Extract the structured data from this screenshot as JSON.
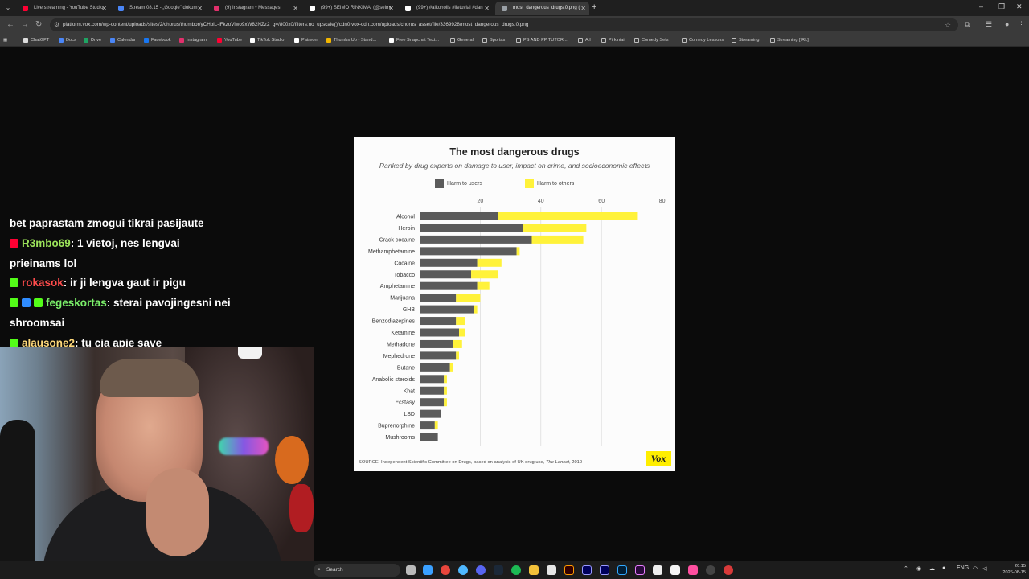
{
  "browser": {
    "tabs": [
      {
        "title": "Live streaming - YouTube Studio",
        "color": "#ff0033"
      },
      {
        "title": "Stream 08.15 - „Google\" dokum",
        "color": "#4a86f7"
      },
      {
        "title": "(9) Instagram • Messages",
        "color": "#e1306c"
      },
      {
        "title": "(99+) SEIMO RINKIMAI (@seimo",
        "color": "#ffffff"
      },
      {
        "title": "(99+) #alkoholis #lietuviai #dan",
        "color": "#ffffff"
      },
      {
        "title": "most_dangerous_drugs.0.png (",
        "color": "#9aa0a6"
      }
    ],
    "new_tab": "+",
    "url": "platform.vox.com/wp-content/uploads/sites/2/chorus/thumbor/yCHbiL-iFkzoViwo9xW82NZz2_g=/800x0/filters:no_upscale()/cdn0.vox-cdn.com/uploads/chorus_asset/file/3369928/most_dangerous_drugs.0.png",
    "bookmarks": [
      {
        "label": "ChatGPT",
        "color": "#dddddd"
      },
      {
        "label": "Docs",
        "color": "#4a86f7"
      },
      {
        "label": "Drive",
        "color": "#1fa463"
      },
      {
        "label": "Calendar",
        "color": "#4a86f7"
      },
      {
        "label": "Facebook",
        "color": "#1877f2"
      },
      {
        "label": "Instagram",
        "color": "#e1306c"
      },
      {
        "label": "YouTube",
        "color": "#ff0033"
      },
      {
        "label": "TikTok Studio",
        "color": "#ffffff"
      },
      {
        "label": "Patreon",
        "color": "#ffffff"
      },
      {
        "label": "Thumbs Up - Stand...",
        "color": "#f2b600"
      },
      {
        "label": "Free Snapchat Text...",
        "color": "#ffffff"
      },
      {
        "label": "General",
        "folder": true
      },
      {
        "label": "Sportas",
        "folder": true
      },
      {
        "label": "PS AND PP TUTOR...",
        "folder": true
      },
      {
        "label": "A.I",
        "folder": true
      },
      {
        "label": "Pirkiniai",
        "folder": true
      },
      {
        "label": "Comedy Sets",
        "folder": true
      },
      {
        "label": "Comedy Lessons",
        "folder": true
      },
      {
        "label": "Streaming",
        "folder": true
      },
      {
        "label": "Streaming [IRL]",
        "folder": true
      }
    ]
  },
  "chat": [
    {
      "user": "",
      "text": "bet paprastam zmogui tikrai pasijaute",
      "user_color": "#ffffff",
      "badges": []
    },
    {
      "user": "R3mbo69",
      "text": ": 1 vietoj, nes lengvai",
      "user_color": "#9be35a",
      "badges": [
        "youtube-icon"
      ]
    },
    {
      "user": "",
      "text": "prieinams lol",
      "user_color": "#ffffff",
      "badges": []
    },
    {
      "user": "rokasok",
      "text": ": ir ji lengva gaut ir pigu",
      "user_color": "#ff4c4c",
      "badges": [
        "kick-icon"
      ]
    },
    {
      "user": "fegeskortas",
      "text": ": sterai pavojingesni nei",
      "user_color": "#7bf06a",
      "badges": [
        "kick-icon",
        "verified-icon",
        "sparkle-icon"
      ]
    },
    {
      "user": "",
      "text": "shroomsai",
      "user_color": "#ffffff",
      "badges": []
    },
    {
      "user": "alausone2",
      "text": ": tu cia apie save",
      "user_color": "#ffd97a",
      "badges": [
        "kick-icon"
      ]
    }
  ],
  "chart_data": {
    "type": "bar",
    "stacked": true,
    "orientation": "horizontal",
    "title": "The most dangerous drugs",
    "subtitle": "Ranked by drug experts on damage to user, impact on crime, and socioeconomic effects",
    "x_ticks": [
      20,
      40,
      60,
      80
    ],
    "xlim": [
      0,
      80
    ],
    "grid": true,
    "legend_position": "top",
    "categories": [
      "Alcohol",
      "Heroin",
      "Crack cocaine",
      "Methamphetamine",
      "Cocaine",
      "Tobacco",
      "Amphetamine",
      "Marijuana",
      "GHB",
      "Benzodiazepines",
      "Ketamine",
      "Methadone",
      "Mephedrone",
      "Butane",
      "Anabolic steroids",
      "Khat",
      "Ecstasy",
      "LSD",
      "Buprenorphine",
      "Mushrooms"
    ],
    "series": [
      {
        "name": "Harm to users",
        "color": "#5b5b5b",
        "values": [
          26,
          34,
          37,
          32,
          19,
          17,
          19,
          12,
          18,
          12,
          13,
          11,
          12,
          10,
          8,
          8,
          8,
          7,
          5,
          6
        ]
      },
      {
        "name": "Harm to others",
        "color": "#fff23a",
        "values": [
          46,
          21,
          17,
          1,
          8,
          9,
          4,
          8,
          1,
          3,
          2,
          3,
          1,
          1,
          1,
          1,
          1,
          0,
          1,
          0
        ]
      }
    ],
    "source": "SOURCE: Independent Scientific Committee on Drugs, based on analysis of UK drug use,",
    "source_journal": "The Lancet",
    "source_year": ", 2010",
    "logo": "Vox"
  },
  "taskbar": {
    "search_label": "Search",
    "lang": "ENG",
    "time": "20:15",
    "date": "2026-08-15"
  }
}
